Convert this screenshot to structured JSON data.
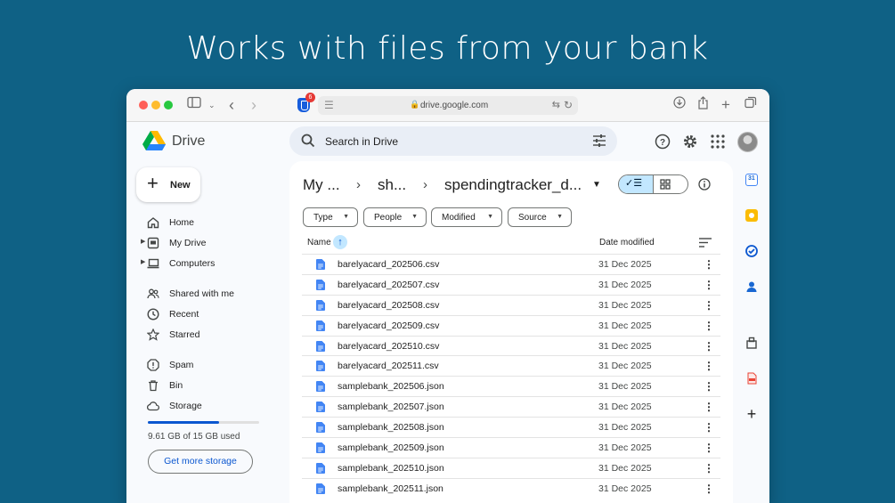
{
  "headline": "Works with files from your bank",
  "browser": {
    "url": "drive.google.com",
    "extension_badge": "6"
  },
  "drive": {
    "brand": "Drive",
    "search_placeholder": "Search in Drive"
  },
  "sidebar": {
    "new_label": "New",
    "items": [
      {
        "label": "Home"
      },
      {
        "label": "My Drive"
      },
      {
        "label": "Computers"
      },
      {
        "label": "Shared with me"
      },
      {
        "label": "Recent"
      },
      {
        "label": "Starred"
      },
      {
        "label": "Spam"
      },
      {
        "label": "Bin"
      },
      {
        "label": "Storage"
      }
    ],
    "storage_used_fraction": 0.64,
    "storage_text": "9.61 GB of 15 GB used",
    "get_more_storage": "Get more storage"
  },
  "breadcrumb": [
    "My ...",
    "sh...",
    "spendingtracker_d..."
  ],
  "filters": [
    "Type",
    "People",
    "Modified",
    "Source"
  ],
  "columns": {
    "name": "Name",
    "date": "Date modified"
  },
  "files": [
    {
      "name": "barelyacard_202506.csv",
      "date": "31 Dec 2025"
    },
    {
      "name": "barelyacard_202507.csv",
      "date": "31 Dec 2025"
    },
    {
      "name": "barelyacard_202508.csv",
      "date": "31 Dec 2025"
    },
    {
      "name": "barelyacard_202509.csv",
      "date": "31 Dec 2025"
    },
    {
      "name": "barelyacard_202510.csv",
      "date": "31 Dec 2025"
    },
    {
      "name": "barelyacard_202511.csv",
      "date": "31 Dec 2025"
    },
    {
      "name": "samplebank_202506.json",
      "date": "31 Dec 2025"
    },
    {
      "name": "samplebank_202507.json",
      "date": "31 Dec 2025"
    },
    {
      "name": "samplebank_202508.json",
      "date": "31 Dec 2025"
    },
    {
      "name": "samplebank_202509.json",
      "date": "31 Dec 2025"
    },
    {
      "name": "samplebank_202510.json",
      "date": "31 Dec 2025"
    },
    {
      "name": "samplebank_202511.json",
      "date": "31 Dec 2025"
    }
  ],
  "colors": {
    "background": "#0f6185",
    "accent": "#0b57d0",
    "selected": "#c2e7ff"
  }
}
